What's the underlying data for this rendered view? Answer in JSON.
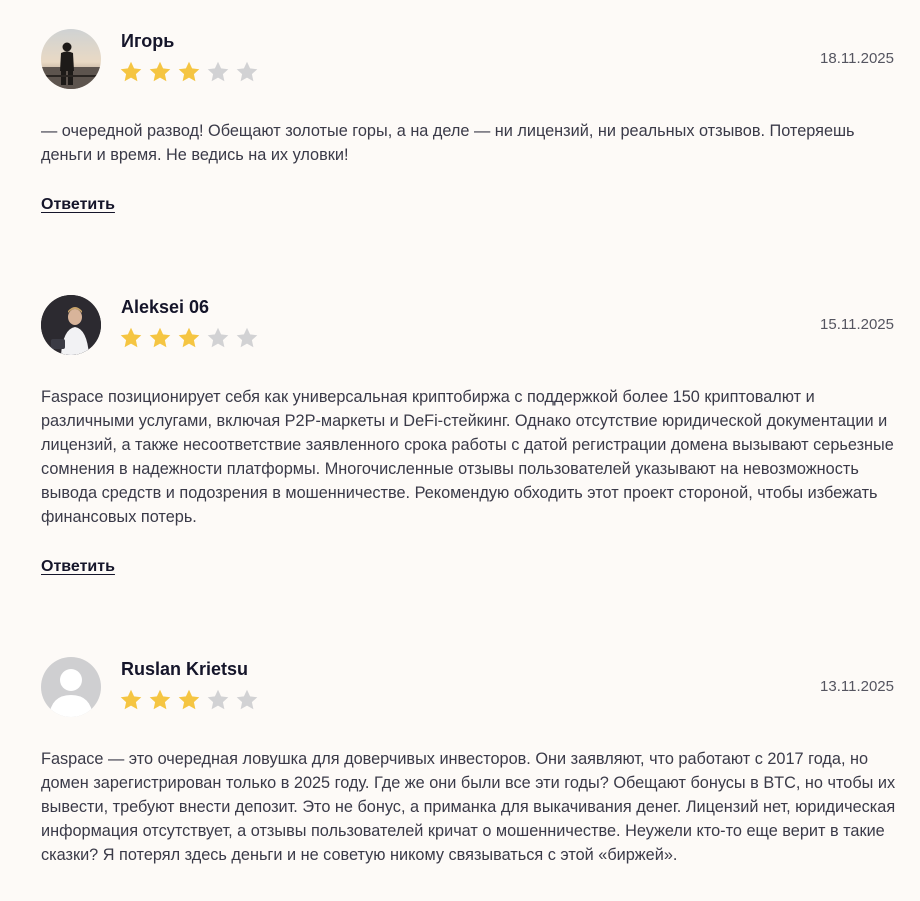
{
  "colors": {
    "background": "#fdfaf7",
    "star_filled": "#f5c542",
    "star_empty": "#d2d2d4",
    "name": "#15152a",
    "text": "#3a3a48"
  },
  "reply_label": "Ответить",
  "reviews": [
    {
      "author": "Игорь",
      "date": "18.11.2025",
      "rating": 3,
      "max_rating": 5,
      "avatar": "photo",
      "text": "— очередной развод! Обещают золотые горы, а на деле — ни лицензий, ни реальных отзывов. Потеряешь деньги и время. Не ведись на их уловки!"
    },
    {
      "author": "Aleksei 06",
      "date": "15.11.2025",
      "rating": 3,
      "max_rating": 5,
      "avatar": "photo",
      "text": "Faspace позиционирует себя как универсальная криптобиржа с поддержкой более 150 криптовалют и различными услугами, включая P2P-маркеты и DeFi-стейкинг. Однако отсутствие юридической документации и лицензий, а также несоответствие заявленного срока работы с датой регистрации домена вызывают серьезные сомнения в надежности платформы. Многочисленные отзывы пользователей указывают на невозможность вывода средств и подозрения в мошенничестве. Рекомендую обходить этот проект стороной, чтобы избежать финансовых потерь."
    },
    {
      "author": "Ruslan Krietsu",
      "date": "13.11.2025",
      "rating": 3,
      "max_rating": 5,
      "avatar": "default-user-icon",
      "text": "Faspace — это очередная ловушка для доверчивых инвесторов. Они заявляют, что работают с 2017 года, но домен зарегистрирован только в 2025 году. Где же они были все эти годы? Обещают бонусы в BTC, но чтобы их вывести, требуют внести депозит. Это не бонус, а приманка для выкачивания денег. Лицензий нет, юридическая информация отсутствует, а отзывы пользователей кричат о мошенничестве. Неужели кто-то еще верит в такие сказки? Я потерял здесь деньги и не советую никому связываться с этой «биржей»."
    }
  ]
}
